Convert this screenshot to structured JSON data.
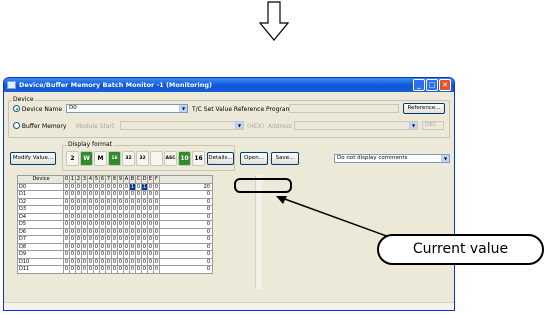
{
  "window": {
    "title": "Device/Buffer Memory Batch Monitor -1 (Monitoring)",
    "buttons": {
      "minimize": "_",
      "maximize": "□",
      "close": "✕"
    }
  },
  "device_group": {
    "title": "Device",
    "device_name_label": "Device Name",
    "device_name_value": "D0",
    "tc_label": "T/C Set Value Reference Program",
    "tc_value": "",
    "reference_button": "Reference...",
    "buffer_memory_label": "Buffer Memory",
    "module_start_label": "Module Start",
    "hex_label": "(HEX)",
    "address_label": "Address",
    "dec_value": "DEC"
  },
  "toolbar": {
    "modify_value_button": "Modify Value...",
    "display_format_label": "Display format",
    "format_buttons": [
      "2",
      "W",
      "M",
      "16",
      "32",
      "32",
      "",
      "ASC",
      "10",
      "16"
    ],
    "details_button": "Details...",
    "open_button": "Open...",
    "save_button": "Save...",
    "comment_select": "Do not display comments"
  },
  "grid": {
    "headers": [
      "Device",
      "0",
      "1",
      "2",
      "3",
      "4",
      "5",
      "6",
      "7",
      "8",
      "9",
      "A",
      "B",
      "C",
      "D",
      "E",
      "F",
      ""
    ],
    "rows": [
      {
        "device": "D0",
        "bits": [
          "0",
          "0",
          "0",
          "0",
          "0",
          "0",
          "0",
          "0",
          "0",
          "0",
          "0",
          "1",
          "0",
          "1",
          "0",
          "0"
        ],
        "value": "20"
      },
      {
        "device": "D1",
        "bits": [
          "0",
          "0",
          "0",
          "0",
          "0",
          "0",
          "0",
          "0",
          "0",
          "0",
          "0",
          "0",
          "0",
          "0",
          "0",
          "0"
        ],
        "value": "0"
      },
      {
        "device": "D2",
        "bits": [
          "0",
          "0",
          "0",
          "0",
          "0",
          "0",
          "0",
          "0",
          "0",
          "0",
          "0",
          "0",
          "0",
          "0",
          "0",
          "0"
        ],
        "value": "0"
      },
      {
        "device": "D3",
        "bits": [
          "0",
          "0",
          "0",
          "0",
          "0",
          "0",
          "0",
          "0",
          "0",
          "0",
          "0",
          "0",
          "0",
          "0",
          "0",
          "0"
        ],
        "value": "0"
      },
      {
        "device": "D4",
        "bits": [
          "0",
          "0",
          "0",
          "0",
          "0",
          "0",
          "0",
          "0",
          "0",
          "0",
          "0",
          "0",
          "0",
          "0",
          "0",
          "0"
        ],
        "value": "0"
      },
      {
        "device": "D5",
        "bits": [
          "0",
          "0",
          "0",
          "0",
          "0",
          "0",
          "0",
          "0",
          "0",
          "0",
          "0",
          "0",
          "0",
          "0",
          "0",
          "0"
        ],
        "value": "0"
      },
      {
        "device": "D6",
        "bits": [
          "0",
          "0",
          "0",
          "0",
          "0",
          "0",
          "0",
          "0",
          "0",
          "0",
          "0",
          "0",
          "0",
          "0",
          "0",
          "0"
        ],
        "value": "0"
      },
      {
        "device": "D7",
        "bits": [
          "0",
          "0",
          "0",
          "0",
          "0",
          "0",
          "0",
          "0",
          "0",
          "0",
          "0",
          "0",
          "0",
          "0",
          "0",
          "0"
        ],
        "value": "0"
      },
      {
        "device": "D8",
        "bits": [
          "0",
          "0",
          "0",
          "0",
          "0",
          "0",
          "0",
          "0",
          "0",
          "0",
          "0",
          "0",
          "0",
          "0",
          "0",
          "0"
        ],
        "value": "0"
      },
      {
        "device": "D9",
        "bits": [
          "0",
          "0",
          "0",
          "0",
          "0",
          "0",
          "0",
          "0",
          "0",
          "0",
          "0",
          "0",
          "0",
          "0",
          "0",
          "0"
        ],
        "value": "0"
      },
      {
        "device": "D10",
        "bits": [
          "0",
          "0",
          "0",
          "0",
          "0",
          "0",
          "0",
          "0",
          "0",
          "0",
          "0",
          "0",
          "0",
          "0",
          "0",
          "0"
        ],
        "value": "0"
      },
      {
        "device": "D11",
        "bits": [
          "0",
          "0",
          "0",
          "0",
          "0",
          "0",
          "0",
          "0",
          "0",
          "0",
          "0",
          "0",
          "0",
          "0",
          "0",
          "0"
        ],
        "value": "0"
      }
    ]
  },
  "callout": {
    "label": "Current value"
  },
  "colors": {
    "title_bar": "#0d56d8",
    "window_bg": "#ece9d8",
    "selection": "#0b3a9e"
  }
}
